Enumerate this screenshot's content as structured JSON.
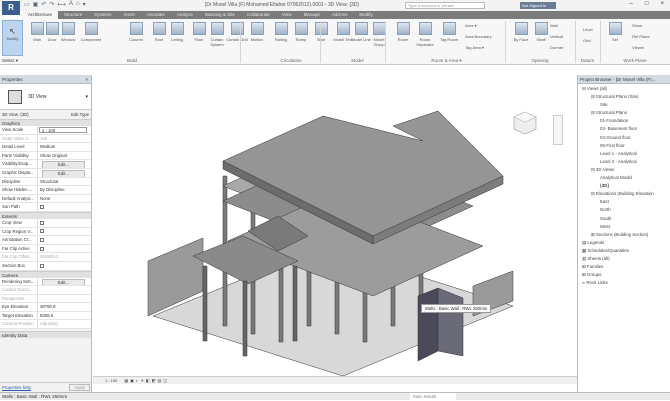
{
  "window": {
    "title": "[Dr Mosel Villa (F) Mohamed Eltaher 07062012).0001 - 3D View: {3D}",
    "search_placeholder": "Type a keyword or phrase",
    "user": "Not Signed In",
    "app_letter": "R"
  },
  "tabs": [
    "Architecture",
    "Structure",
    "Systems",
    "Insert",
    "Annotate",
    "Analyze",
    "Massing & Site",
    "Collaborate",
    "View",
    "Manage",
    "Add-Ins",
    "Modify"
  ],
  "ribbon": {
    "modify": "Modify",
    "select": "Select ▾",
    "build": [
      "Wall",
      "Door",
      "Window",
      "Component",
      "Column",
      "Roof",
      "Ceiling",
      "Floor",
      "Curtain System",
      "Curtain Grid",
      "Mullion"
    ],
    "circulation": [
      "Railing",
      "Ramp",
      "Stair"
    ],
    "model": [
      "Model Text",
      "Model Line",
      "Model Group"
    ],
    "room": [
      "Room",
      "Room Separator",
      "Tag Room"
    ],
    "room_small": [
      "Area ▾",
      "Area Boundary",
      "Tag Area ▾"
    ],
    "opening": [
      "By Face",
      "Shaft"
    ],
    "opening_small": [
      "Wall",
      "Vertical",
      "Dormer"
    ],
    "datum": [
      "Level",
      "Grid"
    ],
    "workplane": [
      "Set"
    ],
    "workplane_small": [
      "Show",
      "Ref Plane",
      "Viewer"
    ],
    "panels": [
      "Build",
      "Circulation",
      "Model",
      "Room & Area ▾",
      "Opening",
      "Datum",
      "Work Plane"
    ]
  },
  "properties": {
    "title": "Properties",
    "type": "3D View",
    "selector": "3D View: {3D}",
    "edit_type": "Edit Type",
    "sections": [
      "Graphics",
      "Extents",
      "Camera",
      "Identity Data"
    ],
    "graphics": [
      {
        "k": "View Scale",
        "v": "1 : 100",
        "input": true
      },
      {
        "k": "Scale Value 1:",
        "v": "100",
        "dim": true
      },
      {
        "k": "Detail Level",
        "v": "Medium"
      },
      {
        "k": "Parts Visibility",
        "v": "Show Original"
      },
      {
        "k": "Visibility/Grap...",
        "v": "Edit...",
        "btn": true
      },
      {
        "k": "Graphic Displa...",
        "v": "Edit...",
        "btn": true
      },
      {
        "k": "Discipline",
        "v": "Structural"
      },
      {
        "k": "Show Hidden ...",
        "v": "By Discipline"
      },
      {
        "k": "Default Analysi...",
        "v": "None"
      },
      {
        "k": "Sun Path",
        "v": "",
        "check": true
      }
    ],
    "extents": [
      {
        "k": "Crop View",
        "v": "",
        "check": true
      },
      {
        "k": "Crop Region V...",
        "v": "",
        "check": true
      },
      {
        "k": "Annotation Cr...",
        "v": "",
        "check": true
      },
      {
        "k": "Far Clip Active",
        "v": "",
        "check": true
      },
      {
        "k": "Far Clip Offset",
        "v": "304800.0",
        "dim": true
      },
      {
        "k": "Section Box",
        "v": "",
        "check": true
      }
    ],
    "camera": [
      {
        "k": "Rendering Sett...",
        "v": "Edit...",
        "btn": true
      },
      {
        "k": "Locked Orient...",
        "v": "",
        "dim": true
      },
      {
        "k": "Perspective",
        "v": "",
        "dim": true
      },
      {
        "k": "Eye Elevation",
        "v": "38780.8"
      },
      {
        "k": "Target Elevation",
        "v": "8308.6"
      },
      {
        "k": "Camera Position",
        "v": "Adjusting",
        "dim": true
      }
    ],
    "help": "Properties help",
    "apply": "Apply"
  },
  "browser": {
    "title": "Project Browser - [Dr Mosel Villa (F)...",
    "items": [
      {
        "t": "⊟ Views (all)",
        "d": 0
      },
      {
        "t": "⊟ Structural Plans (Site)",
        "d": 1
      },
      {
        "t": "Site",
        "d": 2
      },
      {
        "t": "⊟ Structural Plans",
        "d": 1
      },
      {
        "t": "01-Foundation",
        "d": 2
      },
      {
        "t": "02- Basement floor",
        "d": 2
      },
      {
        "t": "04-Ground floor",
        "d": 2
      },
      {
        "t": "05-First floor",
        "d": 2
      },
      {
        "t": "Level 1 - Analytical",
        "d": 2
      },
      {
        "t": "Level 2 - Analytical",
        "d": 2
      },
      {
        "t": "⊟ 3D Views",
        "d": 1
      },
      {
        "t": "Analytical Model",
        "d": 2
      },
      {
        "t": "{3D}",
        "d": 2,
        "bold": true
      },
      {
        "t": "⊟ Elevations (Building Elevation",
        "d": 1
      },
      {
        "t": "East",
        "d": 2
      },
      {
        "t": "North",
        "d": 2
      },
      {
        "t": "South",
        "d": 2
      },
      {
        "t": "West",
        "d": 2
      },
      {
        "t": "⊞ Sections (Building Section)",
        "d": 1
      },
      {
        "t": "▤ Legends",
        "d": 0
      },
      {
        "t": "▦ Schedules/Quantities",
        "d": 0
      },
      {
        "t": "▥ Sheets (all)",
        "d": 0
      },
      {
        "t": "⊞ Families",
        "d": 0
      },
      {
        "t": "⊞ Groups",
        "d": 0
      },
      {
        "t": "∞ Revit Links",
        "d": 0
      }
    ]
  },
  "viewport": {
    "tooltip": "Walls : Basic Wall : RWL 250mm",
    "scale": "1 : 100"
  },
  "status": {
    "text": "Walls : Basic Wall : RWL 250mm",
    "model": "Main Model"
  },
  "colors": {
    "accent": "#3a5f8c",
    "tab_bar": "#7b7b7b",
    "model_gray": "#8c8c8c"
  }
}
